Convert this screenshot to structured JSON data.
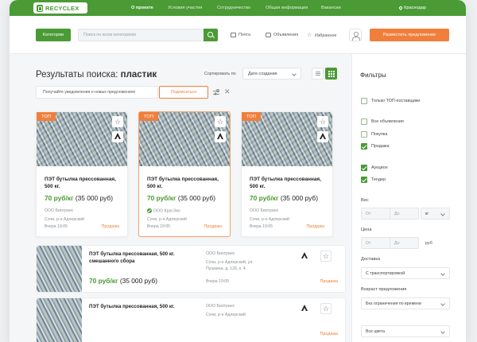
{
  "brand": {
    "name": "RECYCLEX"
  },
  "nav": {
    "items": [
      "О проекте",
      "Условия участия",
      "Сотрудничество",
      "Общая информация",
      "Вакансии"
    ],
    "city": "Краснодар"
  },
  "header": {
    "categories_label": "Категории",
    "search_placeholder": "Поиск по всем категориям",
    "mail_label": "Почта",
    "ads_label": "Объявления",
    "favorites_label": "Избранное",
    "post_label": "Разместить предложение"
  },
  "results": {
    "title_prefix": "Результаты поиска:",
    "query": "пластик",
    "sort_label": "Сортировать по",
    "sort_value": "Дате создания",
    "notify_text": "Получайте уведомления о новых предложениях",
    "subscribe_label": "Подписаться"
  },
  "cards": [
    {
      "badge": "ТОП",
      "title": "ПЭТ бутылка прессованная, 500 кг.",
      "price": "70 руб/кг",
      "total": "(35 000 руб)",
      "company": "ООО Биотранс",
      "location": "Сочи, р-н Адлерский",
      "date": "Вчера 19:05",
      "type": "Продажа"
    },
    {
      "badge": "ТОП",
      "title": "ПЭТ бутылка прессованная, 500 кг.",
      "price": "70 руб/кг",
      "total": "(35 000 руб)",
      "company": "ООО КрасЭко",
      "location": "Сочи, р-н Адлерский",
      "date": "Вчера 19:05",
      "type": "Продажа"
    },
    {
      "badge": "ТОП",
      "title": "ПЭТ бутылка прессованная, 500 кг.",
      "price": "70 руб/кг",
      "total": "(35 000 руб)",
      "company": "ООО Биотранс",
      "location": "Сочи, р-н Адлерский",
      "date": "Вчера 19:05",
      "type": "Продажа"
    }
  ],
  "rows": [
    {
      "title": "ПЭТ бутылка прессованная, 500 кг. смешанного сбора",
      "price": "70 руб/кг",
      "total": "(35 000 руб)",
      "company": "ООО Биотранс",
      "address": "Сочи, р-н Адлерский, ул. Пушкина, д. 126, к. 4",
      "date": "Вчера 19:05",
      "type": "Продажа"
    },
    {
      "title": "ПЭТ бутылка прессованная, 500 кг.",
      "price": "",
      "total": "",
      "company": "ООО Биотранс",
      "address": "Сочи, р-н Адлерский",
      "date": "",
      "type": "Продажа"
    }
  ],
  "filters": {
    "title": "Фильтры",
    "top_only": "Только ТОП-поставщики",
    "all_ads": "Все объявления",
    "purchase": "Покупка",
    "sale": "Продажа",
    "auction": "Аукцион",
    "tender": "Тендер",
    "weight_label": "Вес",
    "from": "От",
    "to": "До",
    "unit_kg": "кг",
    "price_label": "Цена",
    "unit_rub": "руб",
    "delivery_label": "Доставка",
    "delivery_value": "С транспортировкой",
    "age_label": "Возраст предложения",
    "age_value": "Без ограничения по времени",
    "colors_value": "Все цвета"
  }
}
